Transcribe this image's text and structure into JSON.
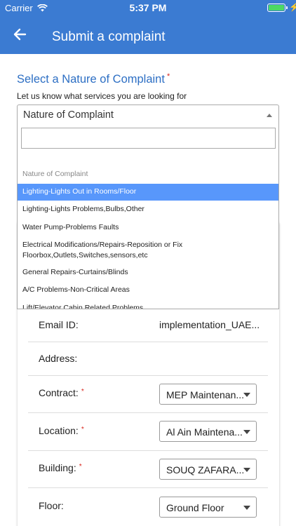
{
  "status_bar": {
    "carrier": "Carrier",
    "time": "5:37 PM",
    "icons": [
      "wifi-icon",
      "battery-icon",
      "charging-bolt-icon"
    ]
  },
  "header": {
    "title": "Submit a complaint",
    "back_icon": "arrow-left-icon",
    "color": "#3b7bd2"
  },
  "section": {
    "title": "Select a Nature of Complaint",
    "required_mark": "*",
    "subtitle": "Let us know what services you are looking for"
  },
  "select": {
    "value": "Nature of Complaint",
    "search_value": "",
    "group_label": "Nature of Complaint",
    "options": [
      "Lighting-Lights Out in Rooms/Floor",
      "Lighting-Lights Problems,Bulbs,Other",
      "Water Pump-Problems Faults",
      "Electrical Modifications/Repairs-Reposition or Fix Floorbox,Outlets,Switches,sensors,etc",
      "General Repairs-Curtains/Blinds",
      "A/C Problems-Non-Critical Areas",
      "Lift/Elevator Cabin Related Problems"
    ],
    "highlight_color": "#5897fb"
  },
  "form": {
    "email": {
      "label": "Email ID:",
      "value": "implementation_UAE..."
    },
    "address": {
      "label": "Address:",
      "value": ""
    },
    "contract": {
      "label": "Contract:",
      "required": "*",
      "value": "MEP Maintenan..."
    },
    "location": {
      "label": "Location:",
      "required": "*",
      "value": "Al Ain Maintena..."
    },
    "building": {
      "label": "Building:",
      "required": "*",
      "value": "SOUQ ZAFARA..."
    },
    "floor": {
      "label": "Floor:",
      "value": "Ground Floor"
    }
  }
}
